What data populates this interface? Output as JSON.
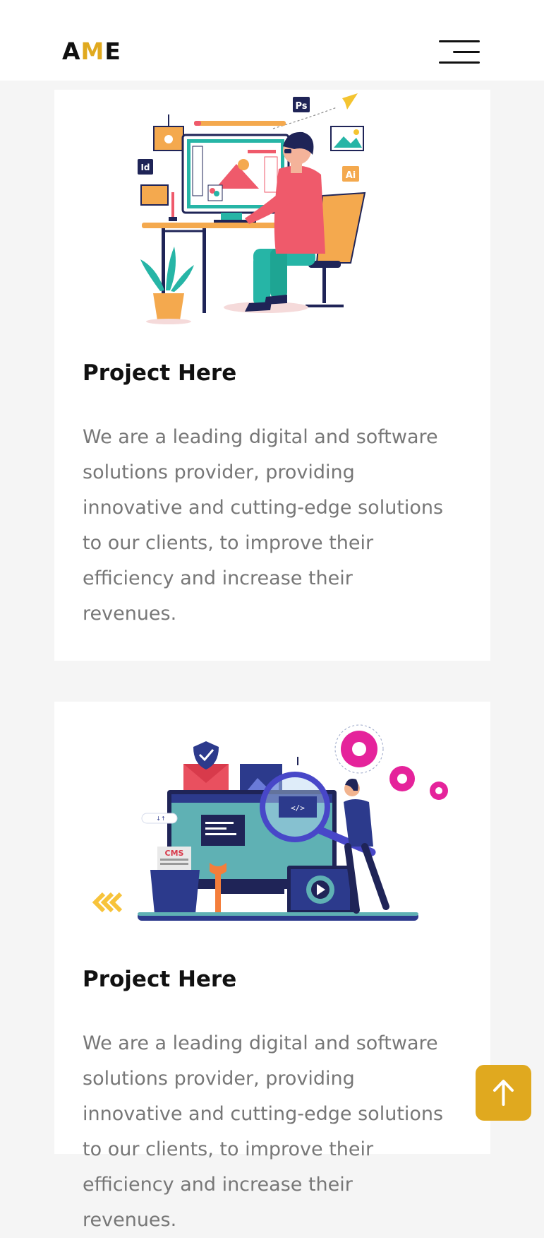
{
  "header": {
    "logo_prefix": "A",
    "logo_accent": "M",
    "logo_suffix": "E",
    "accent_color": "#e0a91f"
  },
  "projects": [
    {
      "title": "Project Here",
      "description": "We are a leading digital and software solutions provider, providing innovative and cutting-edge solutions to our clients, to improve their efficiency and increase their revenues.",
      "illustration": "designer-at-desk-illustration"
    },
    {
      "title": "Project Here",
      "description": "We are a leading digital and software solutions provider, providing innovative and cutting-edge solutions to our clients, to improve their efficiency and increase their revenues.",
      "illustration": "web-development-illustration"
    }
  ],
  "illustration_text": {
    "ps": "Ps",
    "id": "Id",
    "ai": "Ai",
    "cms": "CMS",
    "code": "</>"
  },
  "icons": {
    "menu": "hamburger-menu-icon",
    "scroll_top": "arrow-up-icon"
  }
}
